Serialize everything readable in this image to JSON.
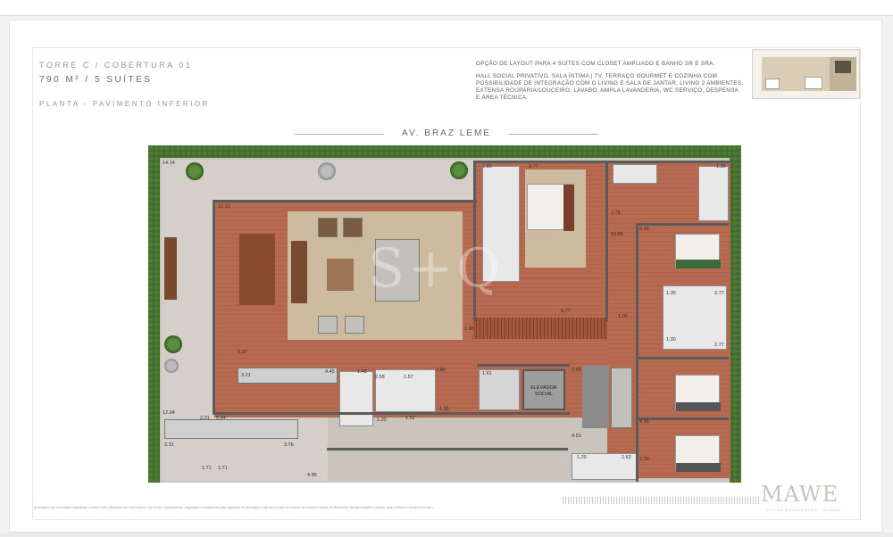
{
  "header": {
    "tower": "TORRE C / COBERTURA 01",
    "size": "790 M² / 5 SUÍTES",
    "floor": "PLANTA - PAVIMENTO INFERIOR"
  },
  "description": {
    "line1": "OPÇÃO DE LAYOUT PARA 4 SUÍTES COM CLOSET AMPLIADO E BANHO SR E SRA.",
    "line2": "HALL SOCIAL PRIVATIVO, SALA ÍNTIMA | TV, TERRAÇO GOURMET E COZINHA COM POSSIBILIDADE DE INTEGRAÇÃO COM O LIVING E SALA DE JANTAR, LIVING 2 AMBIENTES, EXTENSA ROUPARIA/LOUCEIRO, LAVABO, AMPLA LAVANDERIA, WC SERVIÇO, DESPENSA E ÁREA TÉCNICA."
  },
  "street": "AV. BRAZ LEME",
  "elevator": "ELEVADOR SOCIAL",
  "dimensions": {
    "d1": "14.14",
    "d2": "12.12",
    "d3": "1.80",
    "d4": "3.77",
    "d5": "1.36",
    "d6": "2.76",
    "d7": "4.16",
    "d8": "10.86",
    "d9": "1.30",
    "d10": "2.77",
    "d11": "5.77",
    "d12": "1.00",
    "d13": "2.77",
    "d14": "1.30",
    "d15": "9.37",
    "d16": "3.21",
    "d17": "4.45",
    "d18": "1.43",
    "d19": "2.58",
    "d20": "1.57",
    "d21": "2.80",
    "d22": "1.61",
    "d23": "3.00",
    "d24": "12.94",
    "d25": "2.31",
    "d26": "5.54",
    "d27": "2.31",
    "d28": "3.76",
    "d29": "1.20",
    "d30": "1.52",
    "d31": "1.92",
    "d32": "4.16",
    "d33": "1.71",
    "d34": "1.71",
    "d35": "4.95",
    "d36": "1.20",
    "d37": "2.62",
    "d38": "2.39",
    "d39": "4.51",
    "d40": "1.90"
  },
  "logo": "MAWE",
  "logo_sub": "VILLAS RESIDENCES · MOEMA",
  "footer": "As imagens são meramente ilustrativas e podem sofrer alterações sem aviso prévio. Os móveis, equipamentos, vegetação e acabamentos são sugestões de decoração e não fazem parte do contrato de compra e venda. As dimensões são aproximadas e podem variar conforme o projeto executivo.",
  "watermark": "S+Q",
  "colors": {
    "hedge": "#3e6a2a",
    "wood": "#b86a50",
    "wall": "#5b5b5b"
  }
}
